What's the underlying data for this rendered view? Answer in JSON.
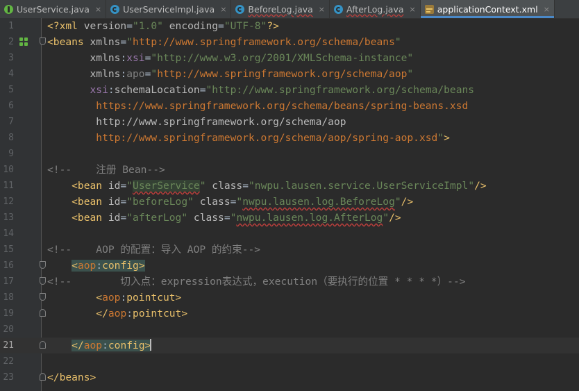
{
  "tabs": [
    {
      "label": "UserService.java",
      "icon": "interface-icon",
      "active": false,
      "warn": false
    },
    {
      "label": "UserServiceImpl.java",
      "icon": "class-icon",
      "active": false,
      "warn": false
    },
    {
      "label": "BeforeLog.java",
      "icon": "class-icon",
      "active": false,
      "warn": true
    },
    {
      "label": "AfterLog.java",
      "icon": "class-icon",
      "active": false,
      "warn": true
    },
    {
      "label": "applicationContext.xml",
      "icon": "xml-icon",
      "active": true,
      "warn": false
    }
  ],
  "close_glyph": "×",
  "current_line": 21,
  "lines": [
    {
      "n": "1",
      "fold": "",
      "segs": [
        [
          "tag",
          "<?xml "
        ],
        [
          "attr",
          "version"
        ],
        [
          "plain",
          "="
        ],
        [
          "val",
          "\"1.0\""
        ],
        [
          "attr",
          " encoding"
        ],
        [
          "plain",
          "="
        ],
        [
          "val",
          "\"UTF-8\""
        ],
        [
          "tag",
          "?>"
        ]
      ]
    },
    {
      "n": "2",
      "fold": "open",
      "gutter_icon": true,
      "segs": [
        [
          "tag",
          "<beans "
        ],
        [
          "attr",
          "xmlns"
        ],
        [
          "plain",
          "="
        ],
        [
          "val",
          "\""
        ],
        [
          "url",
          "http://www.springframework.org/schema/beans"
        ],
        [
          "val",
          "\""
        ]
      ]
    },
    {
      "n": "3",
      "fold": "",
      "segs": [
        [
          "attr",
          "       xmlns"
        ],
        [
          "plain",
          ":"
        ],
        [
          "ns",
          "xsi"
        ],
        [
          "plain",
          "="
        ],
        [
          "val",
          "\"http://www.w3.org/2001/XMLSchema-instance\""
        ]
      ]
    },
    {
      "n": "4",
      "fold": "",
      "segs": [
        [
          "attr",
          "       xmlns"
        ],
        [
          "plain",
          ":"
        ],
        [
          "cmt",
          "apo"
        ],
        [
          "plain",
          "="
        ],
        [
          "val",
          "\""
        ],
        [
          "url",
          "http://www.springframework.org/schema/aop"
        ],
        [
          "val",
          "\""
        ]
      ]
    },
    {
      "n": "5",
      "fold": "",
      "segs": [
        [
          "ns",
          "       xsi"
        ],
        [
          "plain",
          ":"
        ],
        [
          "attr",
          "schemaLocation"
        ],
        [
          "plain",
          "="
        ],
        [
          "val",
          "\"http://www.springframework.org/schema/beans"
        ]
      ]
    },
    {
      "n": "6",
      "fold": "",
      "segs": [
        [
          "url",
          "        https://www.springframework.org/schema/beans/spring-beans.xsd"
        ]
      ]
    },
    {
      "n": "7",
      "fold": "",
      "segs": [
        [
          "attr",
          "        http://www.springframework.org/schema/aop"
        ]
      ]
    },
    {
      "n": "8",
      "fold": "",
      "segs": [
        [
          "url",
          "        http://www.springframework.org/schema/aop/spring-aop.xsd"
        ],
        [
          "val",
          "\""
        ],
        [
          "tag",
          ">"
        ]
      ]
    },
    {
      "n": "9",
      "fold": "",
      "segs": []
    },
    {
      "n": "10",
      "fold": "",
      "segs": [
        [
          "cmt",
          "<!--    注册 Bean-->"
        ]
      ]
    },
    {
      "n": "11",
      "fold": "",
      "segs": [
        [
          "tag",
          "    <bean "
        ],
        [
          "attr",
          "id"
        ],
        [
          "plain",
          "="
        ],
        [
          "val",
          "\""
        ],
        [
          "hlref",
          "UserService"
        ],
        [
          "val",
          "\""
        ],
        [
          "attr",
          " class"
        ],
        [
          "plain",
          "="
        ],
        [
          "val",
          "\"nwpu.lausen.service.UserServiceImpl\""
        ],
        [
          "tag",
          "/>"
        ]
      ]
    },
    {
      "n": "12",
      "fold": "",
      "segs": [
        [
          "tag",
          "    <bean "
        ],
        [
          "attr",
          "id"
        ],
        [
          "plain",
          "="
        ],
        [
          "val",
          "\"beforeLog\""
        ],
        [
          "attr",
          " class"
        ],
        [
          "plain",
          "="
        ],
        [
          "val",
          "\""
        ],
        [
          "valwarn",
          "nwpu.lausen.log.BeforeLog"
        ],
        [
          "val",
          "\""
        ],
        [
          "tag",
          "/>"
        ]
      ]
    },
    {
      "n": "13",
      "fold": "",
      "segs": [
        [
          "tag",
          "    <bean "
        ],
        [
          "attr",
          "id"
        ],
        [
          "plain",
          "="
        ],
        [
          "val",
          "\"afterLog\""
        ],
        [
          "attr",
          " class"
        ],
        [
          "plain",
          "="
        ],
        [
          "val",
          "\""
        ],
        [
          "valwarn",
          "nwpu.lausen.log.AfterLog"
        ],
        [
          "val",
          "\""
        ],
        [
          "tag",
          "/>"
        ]
      ]
    },
    {
      "n": "14",
      "fold": "",
      "segs": []
    },
    {
      "n": "15",
      "fold": "",
      "segs": [
        [
          "cmt",
          "<!--    AOP 的配置：导入 AOP 的约束-->"
        ]
      ]
    },
    {
      "n": "16",
      "fold": "open",
      "segs": [
        [
          "plain",
          "    "
        ],
        [
          "hltag",
          "<"
        ],
        [
          "hlns",
          "aop"
        ],
        [
          "hlplain",
          ":"
        ],
        [
          "hltag",
          "config"
        ],
        [
          "hltag",
          ">"
        ]
      ]
    },
    {
      "n": "17",
      "fold": "open",
      "segs": [
        [
          "cmt",
          "<!--        切入点：expression表达式，execution（要执行的位置 * * * *）-->"
        ]
      ]
    },
    {
      "n": "18",
      "fold": "open",
      "segs": [
        [
          "tag",
          "        <"
        ],
        [
          "ns2",
          "aop"
        ],
        [
          "plain",
          ":"
        ],
        [
          "tag",
          "pointcut"
        ],
        [
          "tag",
          ">"
        ]
      ]
    },
    {
      "n": "19",
      "fold": "close",
      "segs": [
        [
          "tag",
          "        </"
        ],
        [
          "ns2",
          "aop"
        ],
        [
          "plain",
          ":"
        ],
        [
          "tag",
          "pointcut"
        ],
        [
          "tag",
          ">"
        ]
      ]
    },
    {
      "n": "20",
      "fold": "",
      "segs": []
    },
    {
      "n": "21",
      "fold": "close",
      "segs": [
        [
          "plain",
          "    "
        ],
        [
          "hltag",
          "</"
        ],
        [
          "hlns",
          "aop"
        ],
        [
          "hlplain",
          ":"
        ],
        [
          "hltag",
          "config"
        ],
        [
          "hltag",
          ">"
        ],
        [
          "caret",
          ""
        ]
      ]
    },
    {
      "n": "22",
      "fold": "",
      "segs": []
    },
    {
      "n": "23",
      "fold": "close",
      "segs": [
        [
          "tag",
          "</beans>"
        ]
      ]
    }
  ]
}
